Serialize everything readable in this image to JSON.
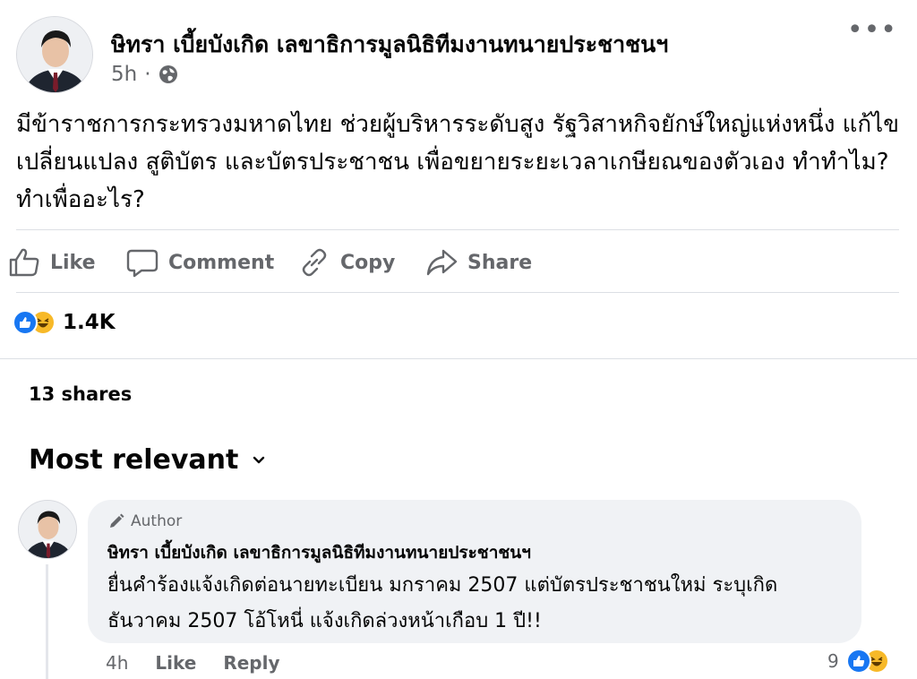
{
  "post": {
    "author": "ษิทรา เบี้ยบังเกิด เลขาธิการมูลนิธิทีมงานทนายประชาชนฯ",
    "time": "5h",
    "privacy_icon": "globe-icon",
    "text": "มีข้าราชการกระทรวงมหาดไทย ช่วยผู้บริหารระดับสูง รัฐวิสาหกิจยักษ์ใหญ่แห่งหนึ่ง แก้ไขเปลี่ยนแปลง สูติบัตร และบัตรประชาชน เพื่อขยายระยะเวลาเกษียณของตัวเอง ทำทำไม? ทำเพื่ออะไร?"
  },
  "actions": {
    "like": "Like",
    "comment": "Comment",
    "copy": "Copy",
    "share": "Share"
  },
  "reactions": {
    "count": "1.4K",
    "types": [
      "like",
      "haha"
    ]
  },
  "shares": "13 shares",
  "sort": {
    "label": "Most relevant"
  },
  "comment": {
    "badge": "Author",
    "author": "ษิทรา เบี้ยบังเกิด เลขาธิการมูลนิธิทีมงานทนายประชาชนฯ",
    "text": "ยื่นคำร้องแจ้งเกิดต่อนายทะเบียน มกราคม 2507 แต่บัตรประชาชนใหม่ ระบุเกิดธันวาคม 2507 โอ้โหนี่ แจ้งเกิดล่วงหน้าเกือบ 1 ปี!!",
    "time": "4h",
    "like": "Like",
    "reply": "Reply",
    "reaction_count": "9"
  },
  "colors": {
    "accent": "#1877f2",
    "haha": "#f7b928",
    "muted_text": "#65676b",
    "bubble": "#f0f2f5"
  }
}
